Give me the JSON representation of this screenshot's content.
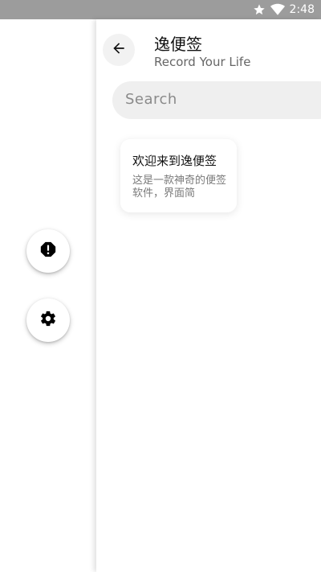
{
  "status_bar": {
    "time": "2:48",
    "icons": [
      "star-icon",
      "wifi-icon"
    ],
    "background": "#9c9c9c"
  },
  "drawer": {
    "buttons": [
      {
        "icon": "alert-icon"
      },
      {
        "icon": "gear-icon"
      }
    ]
  },
  "header": {
    "back_icon": "arrow-back-icon",
    "title": "逸便签",
    "subtitle": "Record Your Life"
  },
  "search": {
    "placeholder": "Search"
  },
  "notes": [
    {
      "title": "欢迎来到逸便签",
      "snippet": "这是一款神奇的便签软件，界面简"
    }
  ]
}
